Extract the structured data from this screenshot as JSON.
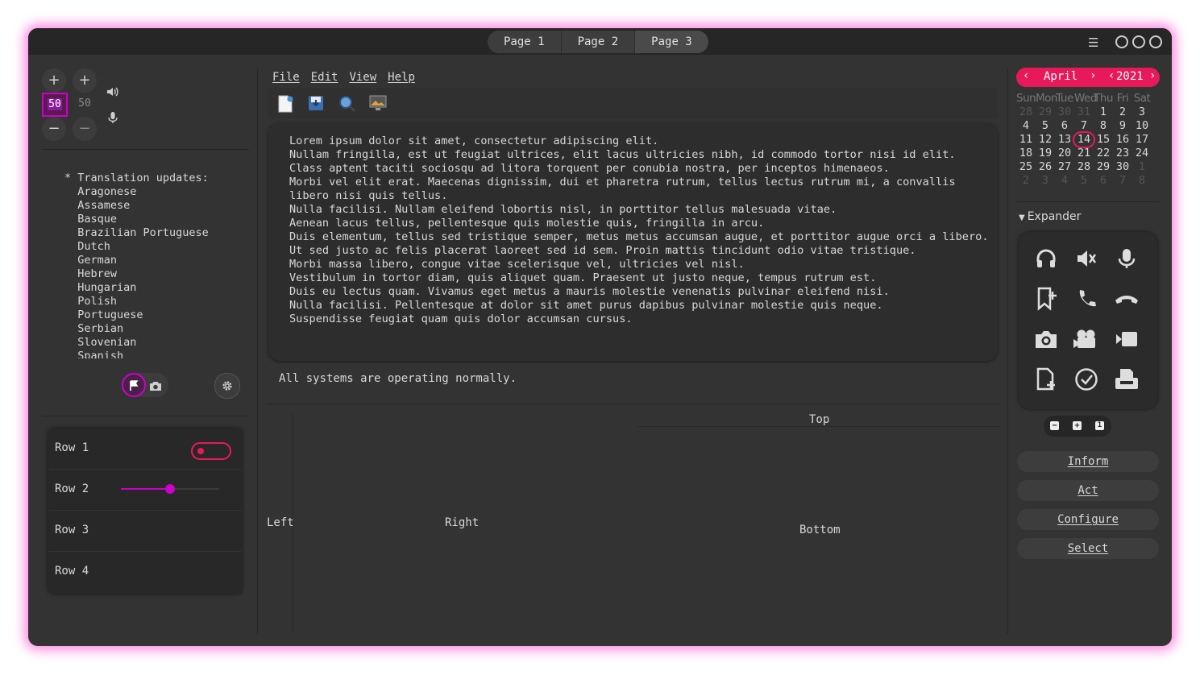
{
  "tabs": [
    {
      "label": "Page 1"
    },
    {
      "label": "Page 2"
    },
    {
      "label": "Page 3"
    }
  ],
  "spin1": {
    "value": "50"
  },
  "spin2": {
    "value": "50"
  },
  "translations": {
    "text": "* Translation updates:\n  Aragonese\n  Assamese\n  Basque\n  Brazilian Portuguese\n  Dutch\n  German\n  Hebrew\n  Hungarian\n  Polish\n  Portuguese\n  Serbian\n  Slovenian\n  Spanish"
  },
  "menu": {
    "file": "File",
    "edit": "Edit",
    "view": "View",
    "help": "Help"
  },
  "editor": {
    "text": "Lorem ipsum dolor sit amet, consectetur adipiscing elit.\nNullam fringilla, est ut feugiat ultrices, elit lacus ultricies nibh, id commodo tortor nisi id elit.\nClass aptent taciti sociosqu ad litora torquent per conubia nostra, per inceptos himenaeos.\nMorbi vel elit erat. Maecenas dignissim, dui et pharetra rutrum, tellus lectus rutrum mi, a convallis\nlibero nisi quis tellus.\nNulla facilisi. Nullam eleifend lobortis nisl, in porttitor tellus malesuada vitae.\nAenean lacus tellus, pellentesque quis molestie quis, fringilla in arcu.\nDuis elementum, tellus sed tristique semper, metus metus accumsan augue, et porttitor augue orci a libero.\nUt sed justo ac felis placerat laoreet sed id sem. Proin mattis tincidunt odio vitae tristique.\nMorbi massa libero, congue vitae scelerisque vel, ultricies vel nisl.\nVestibulum in tortor diam, quis aliquet quam. Praesent ut justo neque, tempus rutrum est.\nDuis eu lectus quam. Vivamus eget metus a mauris molestie venenatis pulvinar eleifend nisi.\nNulla facilisi. Pellentesque at dolor sit amet purus dapibus pulvinar molestie quis neque.\nSuspendisse feugiat quam quis dolor accumsan cursus."
  },
  "status": {
    "text": "All systems are operating normally."
  },
  "panes": {
    "left": "Left",
    "right": "Right",
    "top": "Top",
    "bottom": "Bottom"
  },
  "list": {
    "rows": [
      {
        "label": "Row 1"
      },
      {
        "label": "Row 2"
      },
      {
        "label": "Row 3"
      },
      {
        "label": "Row 4"
      }
    ],
    "slider_value": 0.5
  },
  "calendar": {
    "month": "April",
    "year": "2021",
    "weekdays": [
      "Sun",
      "Mon",
      "Tue",
      "Wed",
      "Thu",
      "Fri",
      "Sat"
    ],
    "prev_days": [
      "28",
      "29",
      "30",
      "31"
    ],
    "days": [
      "1",
      "2",
      "3",
      "4",
      "5",
      "6",
      "7",
      "8",
      "9",
      "10",
      "11",
      "12",
      "13",
      "14",
      "15",
      "16",
      "17",
      "18",
      "19",
      "20",
      "21",
      "22",
      "23",
      "24",
      "25",
      "26",
      "27",
      "28",
      "29",
      "30"
    ],
    "next_days": [
      "1",
      "2",
      "3",
      "4",
      "5",
      "6",
      "7",
      "8"
    ],
    "today": "14"
  },
  "expander": {
    "label": "Expander"
  },
  "actions": {
    "inform": "Inform",
    "act": "Act",
    "configure": "Configure",
    "select": "Select"
  },
  "colors": {
    "accent": "#e8195a",
    "magenta": "#cc00cc",
    "bg": "#333333"
  }
}
